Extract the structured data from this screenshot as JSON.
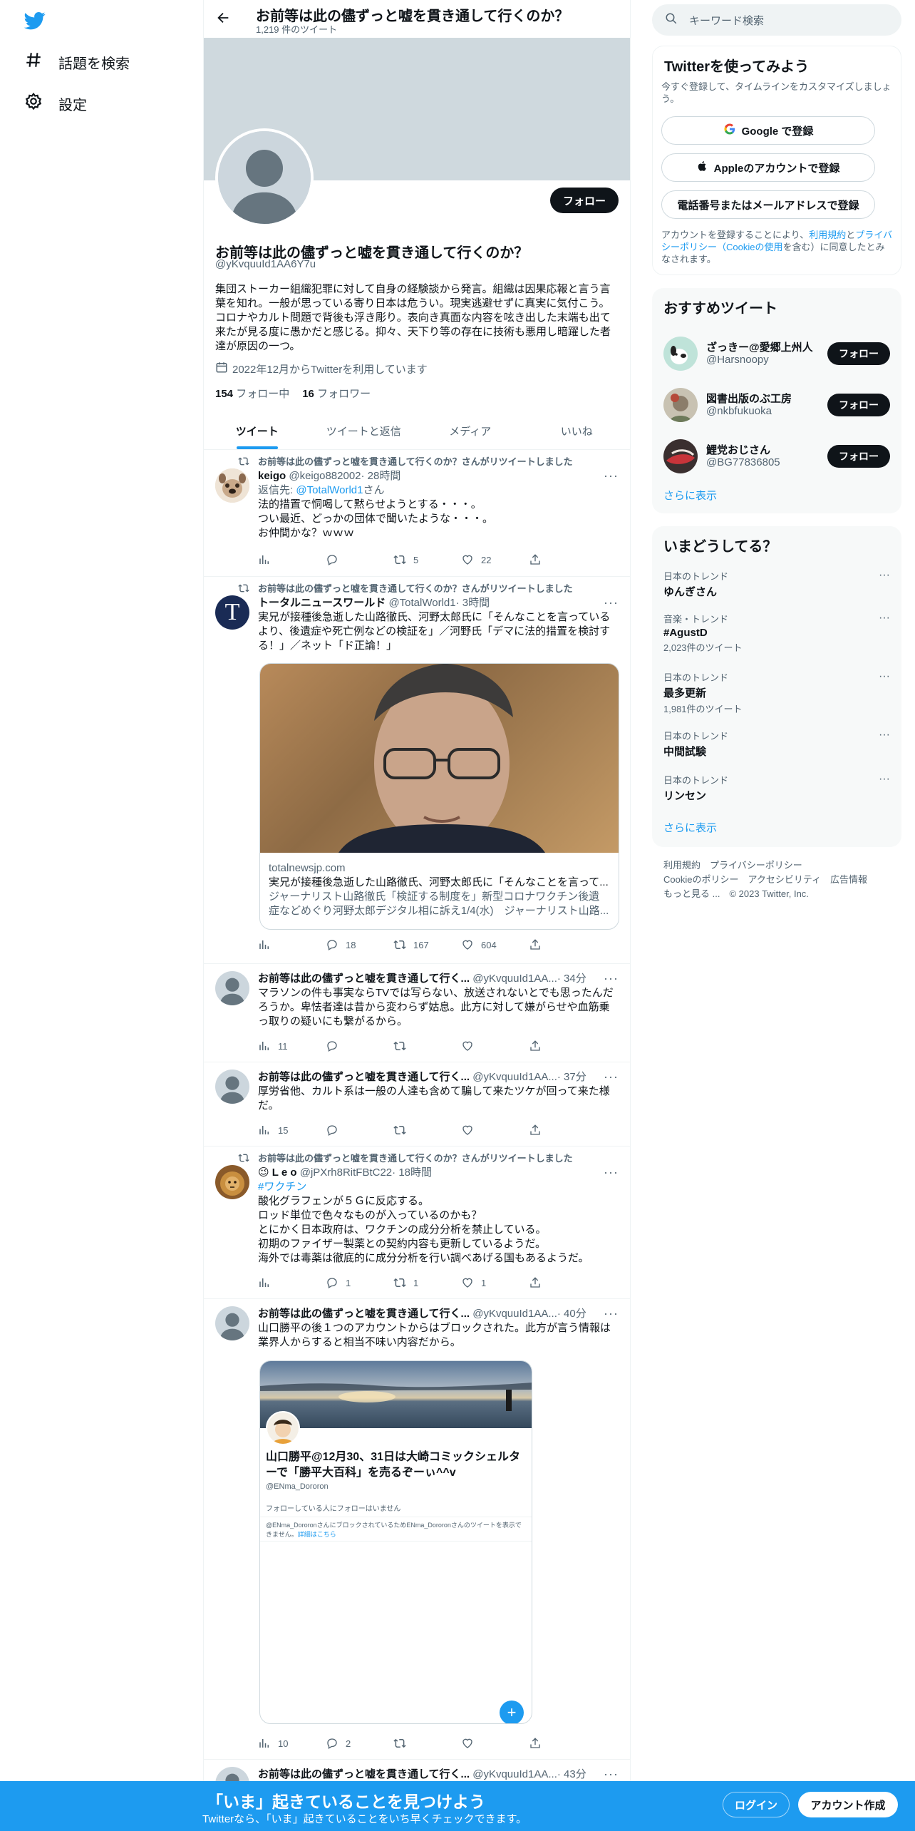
{
  "nav": {
    "items": [
      {
        "label": "話題を検索",
        "icon": "hashtag-icon"
      },
      {
        "label": "設定",
        "icon": "gear-icon"
      }
    ]
  },
  "header": {
    "title": "お前等は此の儘ずっと嘘を貫き通して行くのか？",
    "subtitle": "1,219 件のツイート"
  },
  "profile": {
    "name": "お前等は此の儘ずっと嘘を貫き通して行くのか？",
    "handle": "@yKvquuId1AA6Y7u",
    "bio": "集団ストーカー組織犯罪に対して自身の経験談から発言。組織は因果応報と言う言葉を知れ。一般が思っている寄り日本は危うい。現実逃避せずに真実に気付こう。コロナやカルト問題で背後も浮き彫り。表向き真面な内容を呟き出した末端も出て来たが見る度に愚かだと感じる。抑々、天下り等の存在に技術も悪用し暗躍した者達が原因の一つ。",
    "joined": "2022年12月からTwitterを利用しています",
    "following_count": "154",
    "following_label": "フォロー中",
    "followers_count": "16",
    "followers_label": "フォロワー",
    "follow_button": "フォロー"
  },
  "tabs": [
    "ツイート",
    "ツイートと返信",
    "メディア",
    "いいね"
  ],
  "tweets": [
    {
      "retweet_note": "お前等は此の儘ずっと嘘を貫き通して行くのか？さんがリツイートしました",
      "name": "keigo",
      "handle": "@keigo882002",
      "time": "· 28時間",
      "reply_prefix": "返信先: ",
      "reply_to": "@TotalWorld1",
      "reply_suffix": "さん",
      "text": [
        "法的措置で恫喝して黙らせようとする・・・。",
        "つい最近、どっかの団体で聞いたような・・・。",
        "お仲間かな？ｗｗｗ"
      ],
      "stats": {
        "views": "",
        "replies": "",
        "retweets": "5",
        "likes": "22"
      }
    },
    {
      "retweet_note": "お前等は此の儘ずっと嘘を貫き通して行くのか？さんがリツイートしました",
      "name": "トータルニュースワールド",
      "handle": "@TotalWorld1",
      "time": "· 3時間",
      "text": "実兄が接種後急逝した山路徹氏、河野太郎氏に「そんなことを言っているより、後遺症や死亡例などの検証を」／河野氏「デマに法的措置を検討する！」／ネット「ド正論！」",
      "link_domain": "totalnewsjp.com",
      "link_title": "実兄が接種後急逝した山路徹氏、河野太郎氏に「そんなことを言って...",
      "link_desc": "ジャーナリスト山路徹氏「検証する制度を」新型コロナワクチン後遺症などめぐり河野太郎デジタル相に訴え1/4(水)　ジャーナリスト山路...",
      "stats": {
        "views": "",
        "replies": "18",
        "retweets": "167",
        "likes": "604"
      }
    },
    {
      "name": "お前等は此の儘ずっと嘘を貫き通して行く...",
      "handle": "@yKvquuId1AA...",
      "time": "· 34分",
      "text": "マラソンの件も事実ならTVでは写らない、放送されないとでも思ったんだろうか。卑怯者達は昔から変わらず姑息。此方に対して嫌がらせや血筋乗っ取りの疑いにも繋がるから。",
      "stats": {
        "views": "11",
        "replies": "",
        "retweets": "",
        "likes": ""
      }
    },
    {
      "name": "お前等は此の儘ずっと嘘を貫き通して行く...",
      "handle": "@yKvquuId1AA...",
      "time": "· 37分",
      "text": "厚労省他、カルト系は一般の人達も含めて騙して来たツケが回って来た様だ。",
      "stats": {
        "views": "15",
        "replies": "",
        "retweets": "",
        "likes": ""
      }
    },
    {
      "retweet_note": "お前等は此の儘ずっと嘘を貫き通して行くのか？さんがリツイートしました",
      "name": "😉 L e o",
      "handle": "@jPXrh8RitFBtC22",
      "time": "· 18時間",
      "hashtag": "#ワクチン",
      "text": [
        "酸化グラフェンが５Ｇに反応する。",
        "ロッド単位で色々なものが入っているのかも？",
        "とにかく日本政府は、ワクチンの成分分析を禁止している。",
        "初期のファイザー製薬との契約内容も更新しているようだ。",
        "海外では毒薬は徹底的に成分分析を行い調べあげる国もあるようだ。"
      ],
      "stats": {
        "views": "",
        "replies": "1",
        "retweets": "1",
        "likes": "1"
      }
    },
    {
      "name": "お前等は此の儘ずっと嘘を貫き通して行く...",
      "handle": "@yKvquuId1AA...",
      "time": "· 40分",
      "text": "山口勝平の後１つのアカウントからはブロックされた。此方が言う情報は業界人からすると相当不味い内容だから。",
      "embed": {
        "name": "山口勝平@12月30、31日は大崎コミックシェルターで「勝平大百科」を売るぞーぃ^^v",
        "handle": "@ENma_Dororon",
        "follow_note": "フォローしている人にフォローはいません",
        "block_note": "@ENma_DororonさんにブロックされているためENma_Dororonさんのツイートを表示できません。",
        "block_link": "詳細はこちら"
      },
      "stats": {
        "views": "10",
        "replies": "2",
        "retweets": "",
        "likes": ""
      }
    },
    {
      "name": "お前等は此の儘ずっと嘘を貫き通して行く...",
      "handle": "@yKvquuId1AA...",
      "time": "· 43分"
    }
  ],
  "search": {
    "placeholder": "キーワード検索"
  },
  "signup": {
    "title": "Twitterを使ってみよう",
    "desc": "今すぐ登録して、タイムラインをカスタマイズしましょう。",
    "google": "Google で登録",
    "apple": "Appleのアカウントで登録",
    "phone": "電話番号またはメールアドレスで登録",
    "terms_1": "アカウントを登録することにより、",
    "terms_link_1": "利用規約",
    "terms_2": "と",
    "terms_link_2": "プライバシーポリシー（Cookieの使用",
    "terms_3": "を含む）に同意したとみなされます。"
  },
  "recommend": {
    "title": "おすすめツイート",
    "users": [
      {
        "name": "ざっきー@愛郷上州人",
        "handle": "@Harsnoopy"
      },
      {
        "name": "図書出版のぶ工房",
        "handle": "@nkbfukuoka"
      },
      {
        "name": "鯉党おじさん",
        "handle": "@BG77836805"
      }
    ],
    "follow": "フォロー",
    "more": "さらに表示"
  },
  "trends": {
    "title": "いまどうしてる？",
    "items": [
      {
        "context": "日本のトレンド",
        "name": "ゆんぎさん",
        "count": ""
      },
      {
        "context": "音楽・トレンド",
        "name": "#AgustD",
        "count": "2,023件のツイート"
      },
      {
        "context": "日本のトレンド",
        "name": "最多更新",
        "count": "1,981件のツイート"
      },
      {
        "context": "日本のトレンド",
        "name": "中間試験",
        "count": ""
      },
      {
        "context": "日本のトレンド",
        "name": "リンセン",
        "count": ""
      }
    ],
    "more": "さらに表示"
  },
  "footer": {
    "line1": "利用規約　プライバシーポリシー",
    "line2": "Cookieのポリシー　アクセシビリティ　広告情報",
    "line3": "もっと見る ...　© 2023 Twitter, Inc."
  },
  "bottom": {
    "title": "「いま」起きていることを見つけよう",
    "sub": "Twitterなら、「いま」起きていることをいち早くチェックできます。",
    "login": "ログイン",
    "signup": "アカウント作成"
  },
  "colors": {
    "accent": "#1d9bf0",
    "text": "#0f1419",
    "muted": "#536471",
    "banner": "#cfd9de"
  }
}
